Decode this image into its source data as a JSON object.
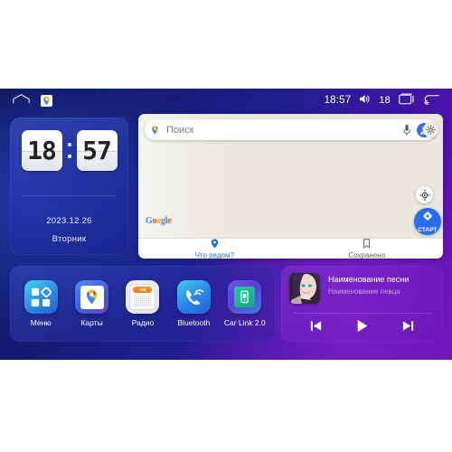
{
  "statusbar": {
    "home_icon": "home-icon",
    "app_icon": "google-maps-icon",
    "time": "18:57",
    "volume_icon": "speaker-icon",
    "volume_level": "18",
    "recents_icon": "recents-icon",
    "back_icon": "back-arrow-icon"
  },
  "clock": {
    "hours": "18",
    "minutes": "57",
    "date": "2023.12.26",
    "weekday": "Вторник"
  },
  "map": {
    "search_placeholder": "Поиск",
    "search_pin_icon": "map-pin-icon",
    "mic_icon": "microphone-icon",
    "avatar_icon": "account-avatar-icon",
    "settings_icon": "gear-icon",
    "compass_icon": "my-location-icon",
    "start_button_label": "СТАРТ",
    "start_button_icon": "navigation-diamond-icon",
    "google_logo": [
      "G",
      "o",
      "o",
      "g",
      "l",
      "e"
    ],
    "tabs": [
      {
        "label": "Что рядом?",
        "icon": "place-pin-icon",
        "active": true
      },
      {
        "label": "Сохранено",
        "icon": "bookmark-icon",
        "active": false
      }
    ]
  },
  "apps": [
    {
      "label": "Меню",
      "icon": "grid-menu-icon"
    },
    {
      "label": "Карты",
      "icon": "google-maps-icon"
    },
    {
      "label": "Радио",
      "icon": "fm-radio-icon",
      "band": "FM"
    },
    {
      "label": "Bluetooth",
      "icon": "bluetooth-phone-icon"
    },
    {
      "label": "Car Link 2.0",
      "icon": "car-link-icon"
    }
  ],
  "music": {
    "album_art_icon": "album-artwork",
    "song_title": "Наименование песни",
    "artist": "Наименование певца",
    "controls": [
      {
        "name": "previous-button",
        "glyph": "prev"
      },
      {
        "name": "play-button",
        "glyph": "play"
      },
      {
        "name": "next-button",
        "glyph": "next"
      }
    ]
  },
  "colors": {
    "accent_blue": "#2a6cf0",
    "google_blue": "#1a73e8",
    "bg_start": "#09114f",
    "bg_end": "#6d0fb4",
    "radio_orange": "#f87a1c"
  }
}
